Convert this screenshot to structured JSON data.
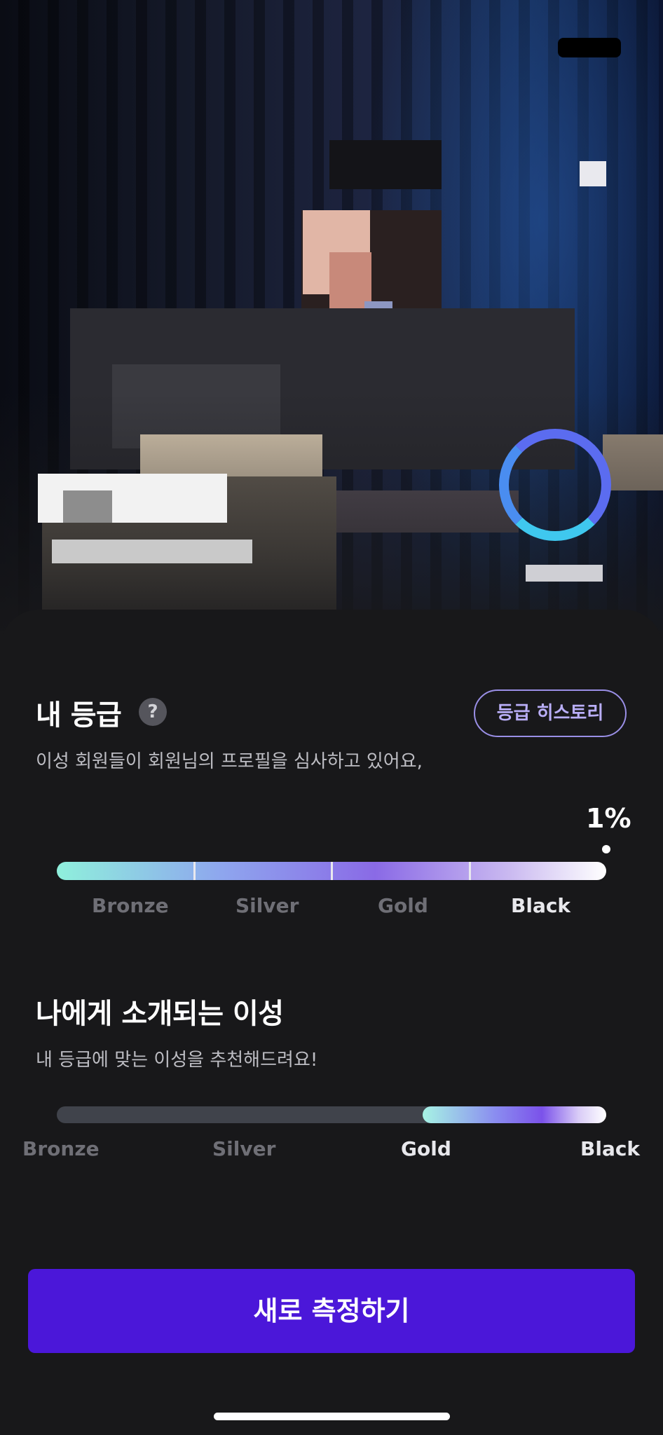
{
  "profile": {
    "photo_desc": "pixelated-performer-photo"
  },
  "grade_section": {
    "title": "내 등급",
    "help_icon": "question-icon",
    "help_symbol": "?",
    "history_button": "등급 히스토리",
    "description": "이성 회원들이 회원님의 프로필을 심사하고 있어요,",
    "percentile": "1%",
    "tiers": [
      "Bronze",
      "Silver",
      "Gold",
      "Black"
    ],
    "active_tier": "Black"
  },
  "intro_section": {
    "title": "나에게 소개되는 이성",
    "description": "내 등급에 맞는 이성을 추천해드려요!",
    "tiers": [
      "Bronze",
      "Silver",
      "Gold",
      "Black"
    ],
    "active_range": [
      "Gold",
      "Black"
    ],
    "range_fraction": [
      0.667,
      1.0
    ]
  },
  "cta": {
    "label": "새로 측정하기"
  },
  "colors": {
    "background": "#18181a",
    "cta": "#4b17d9",
    "history_border": "#9a8fe6",
    "track": "#40434b"
  }
}
